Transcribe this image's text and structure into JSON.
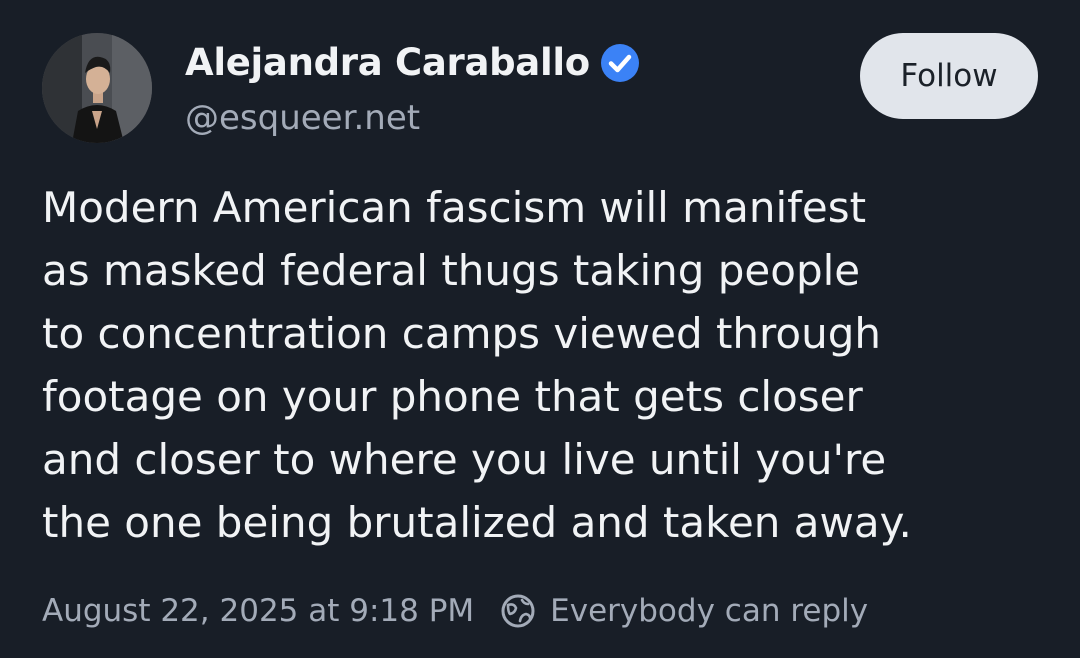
{
  "author": {
    "display_name": "Alejandra Caraballo",
    "handle": "@esqueer.net",
    "verified_icon": "verified-check-icon"
  },
  "actions": {
    "follow_label": "Follow"
  },
  "post": {
    "text": "Modern American fascism will manifest\nas masked federal thugs taking people\nto concentration camps viewed through\nfootage on your phone that gets closer\nand closer to where you live until you're\nthe one being brutalized and taken away.",
    "timestamp": "August 22, 2025 at 9:18 PM",
    "reply_setting": "Everybody can reply",
    "reply_icon": "globe-icon"
  },
  "colors": {
    "background": "#181e27",
    "text_primary": "#f1f3f5",
    "text_secondary": "#a3abb8",
    "follow_button_bg": "#e1e5eb",
    "verified_blue": "#3b82f6"
  }
}
